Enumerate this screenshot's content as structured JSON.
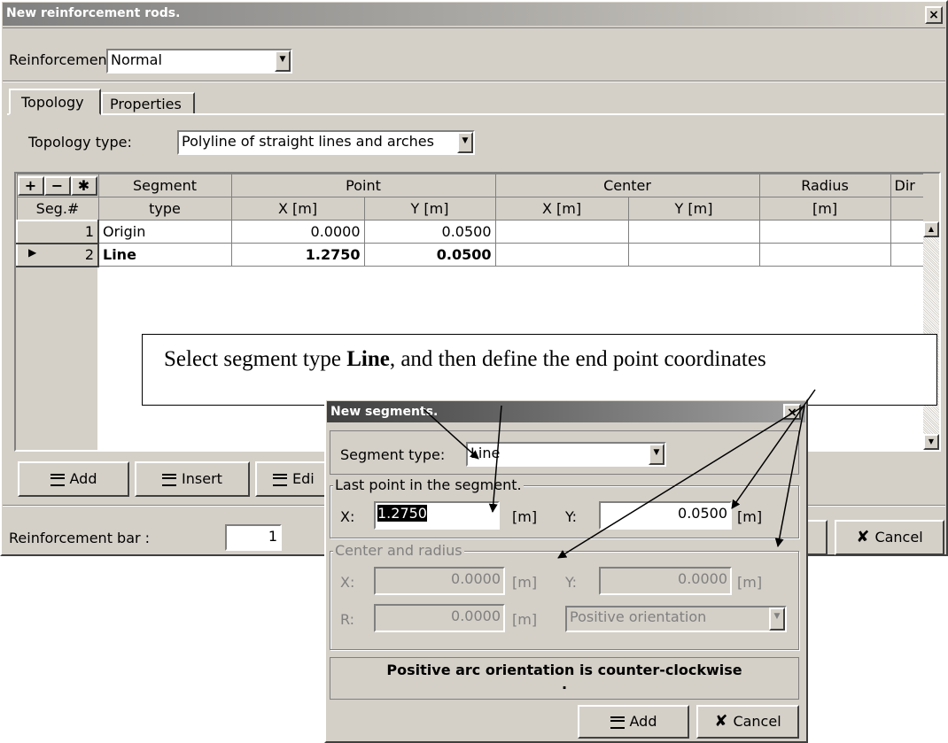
{
  "main_window": {
    "title": "New reinforcement rods.",
    "close_symbol": "×",
    "reinforcement_label": "Reinforcement",
    "reinforcement_value": "Normal",
    "tabs": [
      {
        "label": "Topology"
      },
      {
        "label": "Properties"
      }
    ],
    "topology_type_label": "Topology type:",
    "topology_type_value": "Polyline of straight lines and arches",
    "grid": {
      "tool_buttons": [
        "+",
        "−",
        "✱"
      ],
      "header_row1": [
        "Segment",
        "Point",
        "Center",
        "Radius",
        "Dir"
      ],
      "header_row2": [
        "Seg.#",
        "type",
        "X [m]",
        "Y [m]",
        "X [m]",
        "Y [m]",
        "[m]",
        ""
      ],
      "rows": [
        {
          "num": "1",
          "indicator": "",
          "type": "Origin",
          "px": "0.0000",
          "py": "0.0500",
          "cx": "",
          "cy": "",
          "r": "",
          "dir": ""
        },
        {
          "num": "2",
          "indicator": "▶",
          "type": "Line",
          "px": "1.2750",
          "py": "0.0500",
          "cx": "",
          "cy": "",
          "r": "",
          "dir": ""
        }
      ]
    },
    "buttons": {
      "add": "Add",
      "insert": "Insert",
      "edit": "Edi"
    },
    "bar_label": "Reinforcement bar :",
    "bar_value": "1",
    "cancel": "Cancel"
  },
  "callout": {
    "text_before": "Select segment type ",
    "text_bold": "Line",
    "text_after": ", and then define the end point coordinates"
  },
  "dialog": {
    "title": "New segments.",
    "close_symbol": "×",
    "segment_type_label": "Segment type:",
    "segment_type_value": "Line",
    "last_point_group": "Last point in the segment.",
    "x_label": "X:",
    "x_value": "1.2750",
    "y_label": "Y:",
    "y_value": "0.0500",
    "unit": "[m]",
    "center_group": "Center and radius",
    "cx_label": "X:",
    "cx_value": "0.0000",
    "cy_label": "Y:",
    "cy_value": "0.0000",
    "r_label": "R:",
    "r_value": "0.0000",
    "orientation_value": "Positive orientation",
    "info_text": "Positive arc orientation is counter-clockwise",
    "info_dot": ".",
    "add": "Add",
    "cancel": "Cancel"
  }
}
